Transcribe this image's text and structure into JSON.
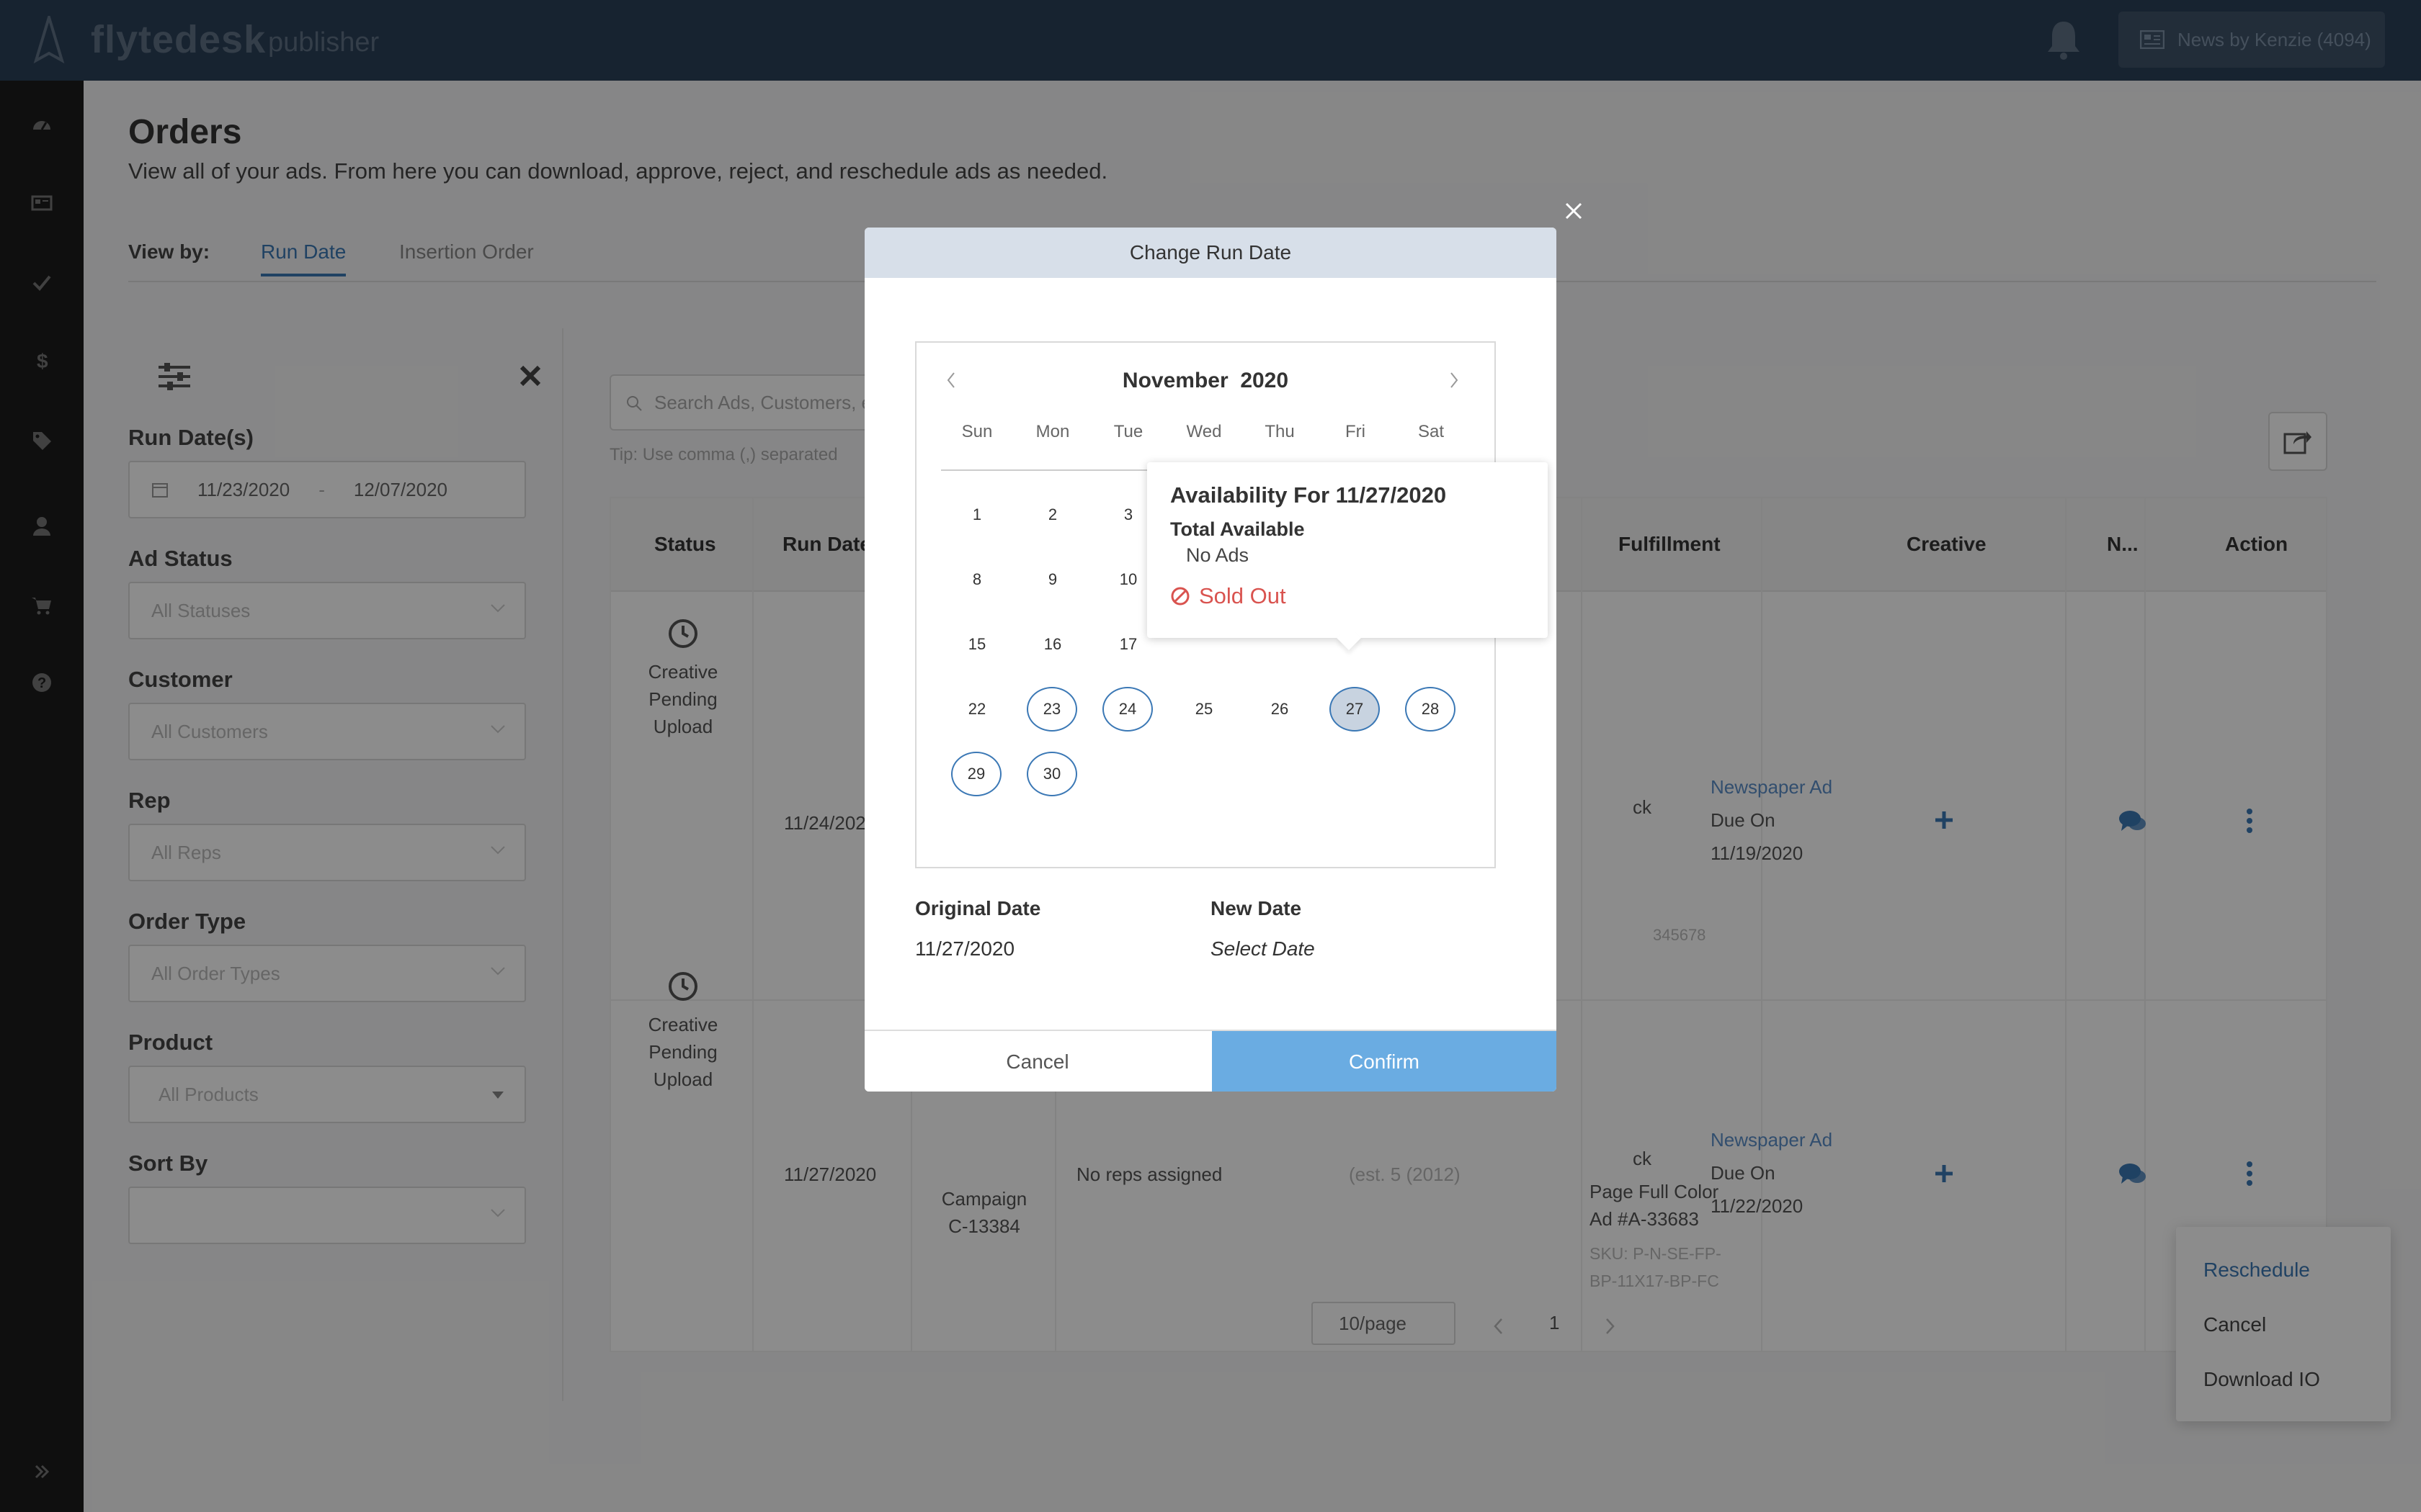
{
  "app": {
    "brand": "flytedesk",
    "product": "publisher"
  },
  "header": {
    "user_label": "News by Kenzie (4094)"
  },
  "page": {
    "title": "Orders",
    "subtitle": "View all of your ads. From here you can download, approve, reject, and reschedule ads as needed.",
    "viewby_label": "View by:",
    "tabs": [
      {
        "label": "Run Date"
      },
      {
        "label": "Insertion Order"
      }
    ]
  },
  "filters": {
    "run_dates_label": "Run Date(s)",
    "date_start": "11/23/2020",
    "date_sep": "-",
    "date_end": "12/07/2020",
    "ad_status_label": "Ad Status",
    "ad_status_placeholder": "All Statuses",
    "customer_label": "Customer",
    "customer_placeholder": "All Customers",
    "rep_label": "Rep",
    "rep_placeholder": "All Reps",
    "order_type_label": "Order Type",
    "order_type_placeholder": "All Order Types",
    "product_label": "Product",
    "product_placeholder": "All Products",
    "sort_label": "Sort By",
    "sort_value": ""
  },
  "search": {
    "placeholder": "Search Ads, Customers, e",
    "tip": "Tip: Use comma (,) separated"
  },
  "table": {
    "headers": {
      "status": "Status",
      "run_date": "Run Date",
      "fulfillment": "Fulfillment",
      "creative": "Creative",
      "notes": "N...",
      "action": "Action"
    },
    "rows": [
      {
        "status_l1": "Creative",
        "status_l2": "Pending",
        "status_l3": "Upload",
        "run_date": "11/24/202",
        "product_frag": "ck",
        "sku_frag": "345678",
        "fulfillment_link": "Newspaper Ad",
        "due_l1": "Due On",
        "due_l2": "11/19/2020"
      },
      {
        "status_l1": "Creative",
        "status_l2": "Pending",
        "status_l3": "Upload",
        "run_date": "11/27/2020",
        "campaign_l1": "Campaign",
        "campaign_l2": "C-13384",
        "reps": "No reps assigned",
        "est": "(est. 5 (2012)",
        "product_frag": "ck",
        "product_l2": "Page Full Color",
        "product_l3": "Ad #A-33683",
        "sku_l1": "SKU: P-N-SE-FP-",
        "sku_l2": "BP-11X17-BP-FC",
        "fulfillment_link": "Newspaper Ad",
        "due_l1": "Due On",
        "due_l2": "11/22/2020"
      }
    ]
  },
  "pagination": {
    "per_page": "10/page",
    "current": "1"
  },
  "context_menu": {
    "items": [
      {
        "label": "Reschedule"
      },
      {
        "label": "Cancel"
      },
      {
        "label": "Download IO"
      }
    ]
  },
  "modal": {
    "title": "Change Run Date",
    "calendar": {
      "month_label": "November",
      "year_label": "2020",
      "weekdays": [
        "Sun",
        "Mon",
        "Tue",
        "Wed",
        "Thu",
        "Fri",
        "Sat"
      ],
      "days": [
        "1",
        "2",
        "3",
        "8",
        "9",
        "10",
        "15",
        "16",
        "17",
        "22",
        "23",
        "24",
        "25",
        "26",
        "27",
        "28",
        "29",
        "30"
      ]
    },
    "original_label": "Original Date",
    "original_value": "11/27/2020",
    "new_label": "New Date",
    "new_value": "Select Date",
    "cancel_label": "Cancel",
    "confirm_label": "Confirm"
  },
  "tooltip": {
    "title": "Availability For 11/27/2020",
    "total_label": "Total Available",
    "total_value": "No Ads",
    "status": "Sold Out"
  },
  "colors": {
    "accent": "#3b78b5",
    "topbar": "#2b4058",
    "confirm": "#6aace2",
    "sold_out": "#d9534f"
  }
}
